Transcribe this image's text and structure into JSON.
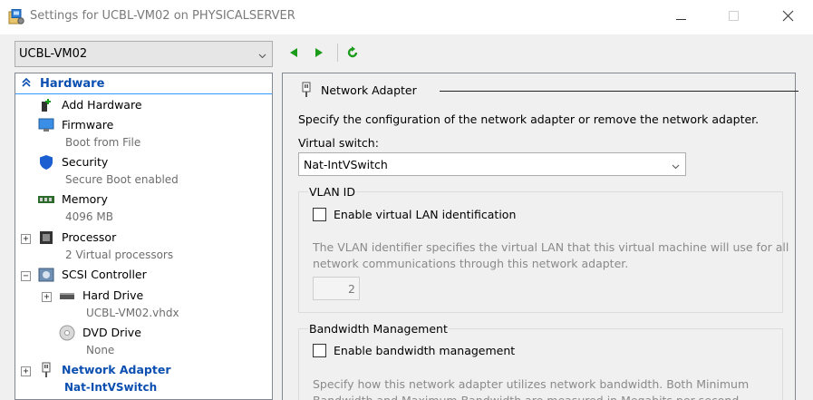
{
  "window": {
    "title": "Settings for UCBL-VM02 on PHYSICALSERVER"
  },
  "vm_selector": {
    "value": "UCBL-VM02"
  },
  "toolbar": {
    "back_icon": "arrow-left-icon",
    "forward_icon": "arrow-right-icon",
    "refresh_icon": "refresh-icon"
  },
  "tree": {
    "section_label": "Hardware",
    "items": [
      {
        "name": "Add Hardware",
        "sub": ""
      },
      {
        "name": "Firmware",
        "sub": "Boot from File"
      },
      {
        "name": "Security",
        "sub": "Secure Boot enabled"
      },
      {
        "name": "Memory",
        "sub": "4096 MB"
      },
      {
        "name": "Processor",
        "sub": "2 Virtual processors"
      },
      {
        "name": "SCSI Controller",
        "sub": ""
      },
      {
        "name": "Hard Drive",
        "sub": "UCBL-VM02.vhdx"
      },
      {
        "name": "DVD Drive",
        "sub": "None"
      },
      {
        "name": "Network Adapter",
        "sub": "Nat-IntVSwitch"
      }
    ]
  },
  "details": {
    "section_title": "Network Adapter",
    "description": "Specify the configuration of the network adapter or remove the network adapter.",
    "virtual_switch_label": "Virtual switch:",
    "virtual_switch_value": "Nat-IntVSwitch",
    "vlan": {
      "title": "VLAN ID",
      "checkbox_label": "Enable virtual LAN identification",
      "help_line1": "The VLAN identifier specifies the virtual LAN that this virtual machine will use for all",
      "help_line2": "network communications through this network adapter.",
      "vlan_id": "2"
    },
    "bandwidth": {
      "title": "Bandwidth Management",
      "checkbox_label": "Enable bandwidth management",
      "help_line1": "Specify how this network adapter utilizes network bandwidth. Both Minimum",
      "help_line2": "Bandwidth and Maximum Bandwidth are measured in Megabits per second."
    }
  },
  "colors": {
    "accent": "#0b4fb0",
    "nav_green": "#1a9c1a"
  }
}
